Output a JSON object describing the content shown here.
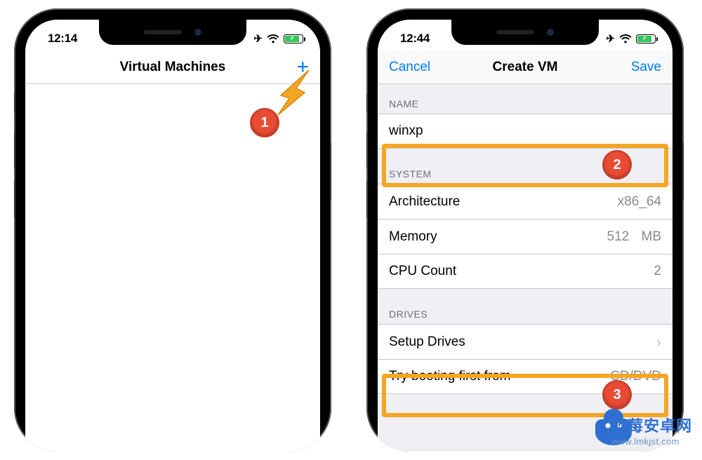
{
  "left_phone": {
    "statusbar": {
      "time": "12:14",
      "battery_pct": 78
    },
    "navbar": {
      "title": "Virtual Machines"
    },
    "callout1": "1"
  },
  "right_phone": {
    "statusbar": {
      "time": "12:44",
      "battery_pct": 78
    },
    "navbar": {
      "left": "Cancel",
      "title": "Create VM",
      "right": "Save"
    },
    "sections": {
      "name_header": "NAME",
      "name_value": "winxp",
      "system_header": "SYSTEM",
      "arch_label": "Architecture",
      "arch_value": "x86_64",
      "memory_label": "Memory",
      "memory_value": "512",
      "memory_unit": "MB",
      "cpu_label": "CPU Count",
      "cpu_value": "2",
      "drives_header": "DRIVES",
      "setup_drives_label": "Setup Drives",
      "boot_label": "Try booting first from",
      "boot_value": "CD/DVD"
    },
    "callout2": "2",
    "callout3": "3"
  },
  "watermark": {
    "brand_cn": "蓝莓安卓网",
    "url": "www.lmkjst.com"
  }
}
